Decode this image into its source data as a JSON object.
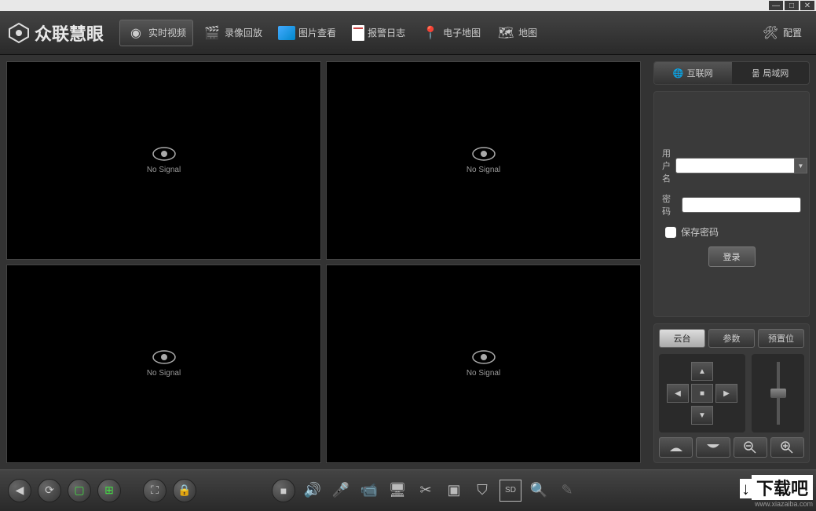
{
  "app_title": "众联慧眼",
  "nav": {
    "live": "实时视频",
    "playback": "录像回放",
    "image": "图片查看",
    "alarm": "报警日志",
    "emap": "电子地图",
    "map": "地图",
    "config": "配置"
  },
  "video": {
    "no_signal": "No Signal"
  },
  "net_tabs": {
    "internet": "互联网",
    "lan": "局域网"
  },
  "login": {
    "username_label": "用户名",
    "password_label": "密码",
    "save_pwd": "保存密码",
    "login_btn": "登录",
    "username_value": "",
    "password_value": ""
  },
  "ptz": {
    "tab_ptz": "云台",
    "tab_param": "参数",
    "tab_preset": "预置位"
  },
  "watermark": {
    "text": "下载吧",
    "url": "www.xiazaiba.com"
  }
}
